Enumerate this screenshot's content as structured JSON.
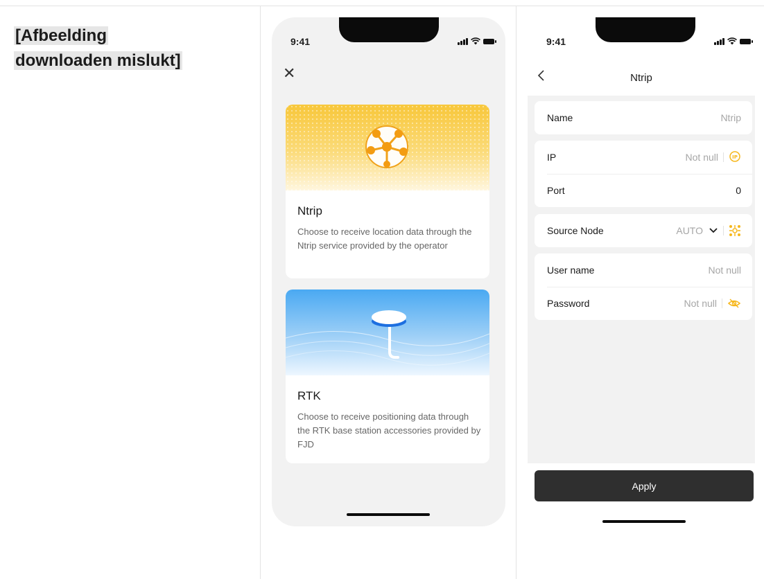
{
  "broken_image": {
    "line1": "[Afbeelding",
    "line2": "downloaden mislukt]"
  },
  "screen1": {
    "time": "9:41",
    "cards": [
      {
        "title": "Ntrip",
        "description": "Choose to receive location data through the Ntrip service provided by the operator"
      },
      {
        "title": "RTK",
        "description": "Choose to receive positioning data through the RTK base station accessories provided by FJD"
      }
    ]
  },
  "screen2": {
    "time": "9:41",
    "title": "Ntrip",
    "fields": {
      "name": {
        "label": "Name",
        "value": "Ntrip"
      },
      "ip": {
        "label": "IP",
        "placeholder": "Not null",
        "icon": "ip-icon"
      },
      "port": {
        "label": "Port",
        "value": "0"
      },
      "source_node": {
        "label": "Source Node",
        "value": "AUTO",
        "icon": "node-refresh-icon"
      },
      "username": {
        "label": "User name",
        "placeholder": "Not null"
      },
      "password": {
        "label": "Password",
        "placeholder": "Not null",
        "icon": "eye-hidden-icon"
      }
    },
    "apply_label": "Apply"
  },
  "colors": {
    "accent": "#f6b71c",
    "button": "#2f2f2f",
    "background": "#f2f2f2"
  }
}
